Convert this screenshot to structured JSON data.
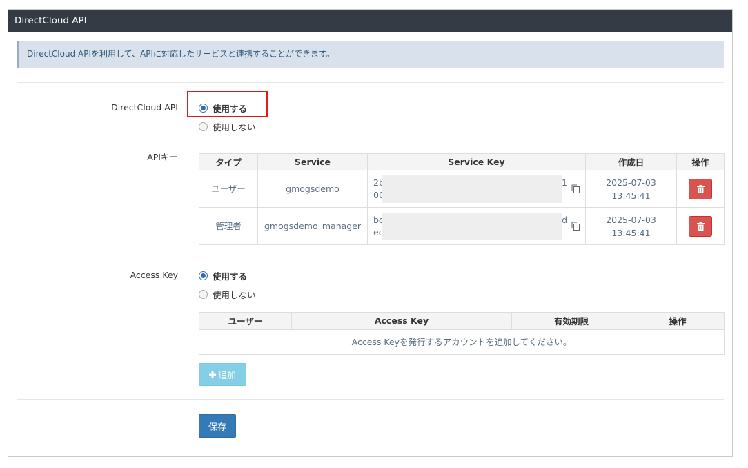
{
  "panel": {
    "title": "DirectCloud API"
  },
  "info": {
    "message": "DirectCloud APIを利用して、APIに対応したサービスと連携することができます。"
  },
  "directcloud_api": {
    "label": "DirectCloud API",
    "options": [
      {
        "label": "使用する",
        "checked": true
      },
      {
        "label": "使用しない",
        "checked": false
      }
    ]
  },
  "api_keys": {
    "label": "APIキー",
    "headers": [
      "タイプ",
      "Service",
      "Service Key",
      "作成日",
      "操作"
    ],
    "rows": [
      {
        "type": "ユーザー",
        "service": "gmogsdemo",
        "key_prefix_1": "2b",
        "key_prefix_2": "00",
        "key_suffix": "1",
        "date": "2025-07-03",
        "time": "13:45:41"
      },
      {
        "type": "管理者",
        "service": "gmogsdemo_manager",
        "key_prefix_1": "bc",
        "key_prefix_2": "ed",
        "key_suffix": "d",
        "date": "2025-07-03",
        "time": "13:45:41"
      }
    ]
  },
  "access_key": {
    "label": "Access Key",
    "options": [
      {
        "label": "使用する",
        "checked": true
      },
      {
        "label": "使用しない",
        "checked": false
      }
    ],
    "headers": [
      "ユーザー",
      "Access Key",
      "有効期限",
      "操作"
    ],
    "empty_message": "Access Keyを発行するアカウントを追加してください。"
  },
  "buttons": {
    "add_label": "追加",
    "save_label": "保存"
  },
  "colors": {
    "header_bg": "#353b45",
    "primary": "#337ab7",
    "info": "#5bc0de",
    "danger": "#d9534f",
    "highlight": "#e11a1a"
  }
}
